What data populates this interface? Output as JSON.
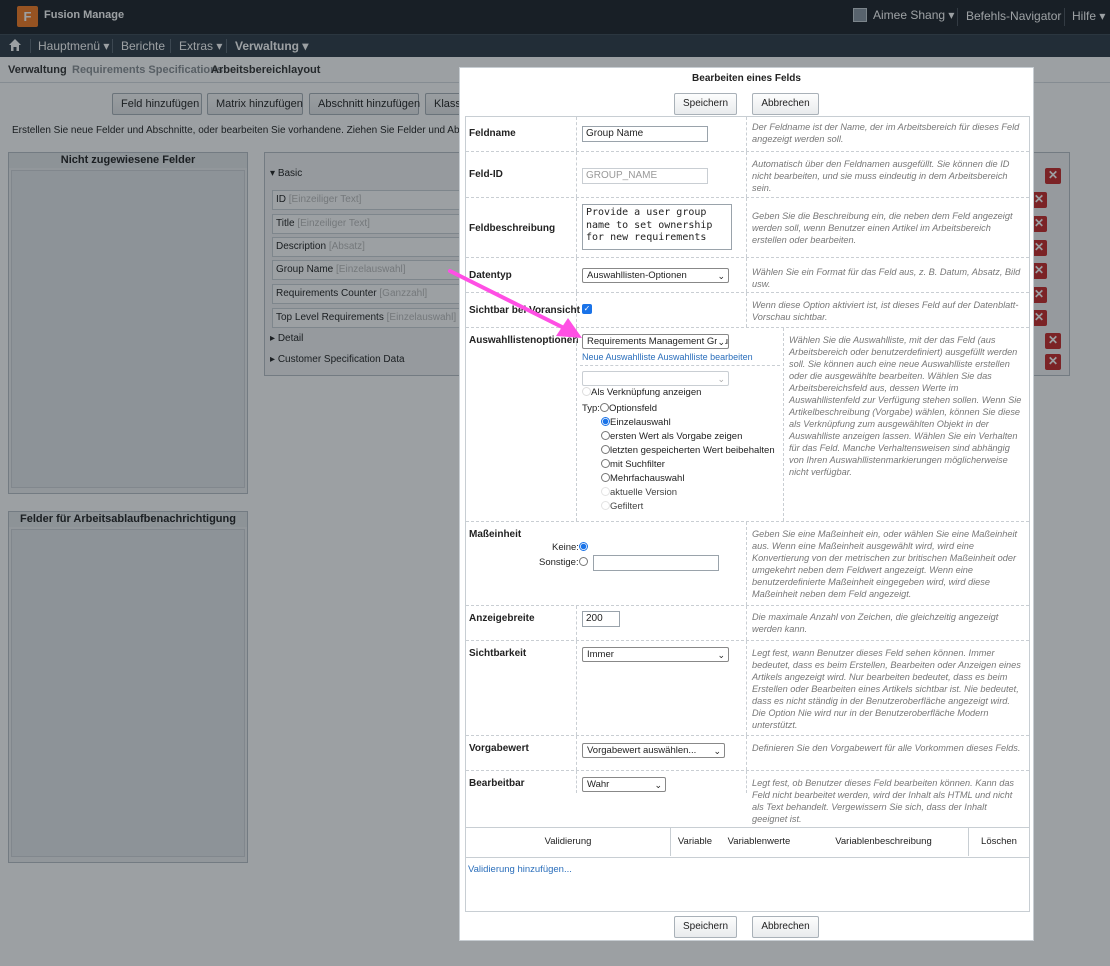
{
  "app": {
    "logo_letter": "F",
    "name": "Fusion Manage"
  },
  "topbar": {
    "user": "Aimee Shang ▾",
    "command_nav": "Befehls-Navigator",
    "help": "Hilfe ▾"
  },
  "nav": {
    "main": "Hauptmenü ▾",
    "reports": "Berichte",
    "extras": "Extras ▾",
    "admin": "Verwaltung ▾"
  },
  "breadcrumb": {
    "root": "Verwaltung",
    "mid": "Requirements Specifications",
    "current": "Arbeitsbereichlayout"
  },
  "background": {
    "buttons": [
      "Feld hinzufügen",
      "Matrix hinzufügen",
      "Abschnitt hinzufügen",
      "Klassi"
    ],
    "instruction": "Erstellen Sie neue Felder und Abschnitte, oder bearbeiten Sie vorhandene. Ziehen Sie Felder und Abschn",
    "unassigned_title": "Nicht zugewiesene Felder",
    "workflow_title": "Felder für Arbeitsablaufbenachrichtigung",
    "sections": {
      "basic": "Basic",
      "detail": "Detail",
      "customer": "Customer Specification Data"
    },
    "fields": [
      {
        "name": "ID",
        "type": "[Einzeiliger Text]"
      },
      {
        "name": "Title",
        "type": "[Einzeiliger Text]"
      },
      {
        "name": "Description",
        "type": "[Absatz]"
      },
      {
        "name": "Group Name",
        "type": "[Einzelauswahl]"
      },
      {
        "name": "Requirements Counter",
        "type": "[Ganzzahl]"
      },
      {
        "name": "Top Level Requirements",
        "type": "[Einzelauswahl]"
      }
    ]
  },
  "dialog": {
    "title": "Bearbeiten eines Felds",
    "save": "Speichern",
    "cancel": "Abbrechen",
    "rows": {
      "fieldname": {
        "label": "Feldname",
        "value": "Group Name",
        "help": "Der Feldname ist der Name, der im Arbeitsbereich für dieses Feld angezeigt werden soll."
      },
      "fieldid": {
        "label": "Feld-ID",
        "value": "GROUP_NAME",
        "help": "Automatisch über den Feldnamen ausgefüllt. Sie können die ID nicht bearbeiten, und sie muss eindeutig in dem Arbeitsbereich sein."
      },
      "description": {
        "label": "Feldbeschreibung",
        "value": "Provide a user group name to set ownership for new requirements",
        "help": "Geben Sie die Beschreibung ein, die neben dem Feld angezeigt werden soll, wenn Benutzer einen Artikel im Arbeitsbereich erstellen oder bearbeiten."
      },
      "datatype": {
        "label": "Datentyp",
        "value": "Auswahllisten-Optionen",
        "help": "Wählen Sie ein Format für das Feld aus, z. B. Datum, Absatz, Bild usw."
      },
      "preview": {
        "label": "Sichtbar bei Voransicht",
        "help": "Wenn diese Option aktiviert ist, ist dieses Feld auf der Datenblatt-Vorschau sichtbar."
      },
      "picklist": {
        "label": "Auswahllistenoptionen",
        "value": "Requirements Management Groups",
        "links": "Neue Auswahlliste Auswahlliste bearbeiten",
        "show_link": "Als Verknüpfung anzeigen",
        "type_label": "Typ:",
        "options": [
          "Optionsfeld",
          "Einzelauswahl",
          "ersten Wert als Vorgabe zeigen",
          "letzten gespeicherten Wert beibehalten",
          "mit Suchfilter",
          "Mehrfachauswahl",
          "aktuelle Version",
          "Gefiltert"
        ],
        "help": "Wählen Sie die Auswahlliste, mit der das Feld (aus Arbeitsbereich oder benutzerdefiniert) ausgefüllt werden soll. Sie können auch eine neue Auswahlliste erstellen oder die ausgewählte bearbeiten. Wählen Sie das Arbeitsbereichsfeld aus, dessen Werte im Auswahllistenfeld zur Verfügung stehen sollen. Wenn Sie Artikelbeschreibung (Vorgabe) wählen, können Sie diese als Verknüpfung zum ausgewählten Objekt in der Auswahlliste anzeigen lassen. Wählen Sie ein Verhalten für das Feld. Manche Verhaltensweisen sind abhängig von Ihren Auswahllistenmarkierungen möglicherweise nicht verfügbar."
      },
      "unit": {
        "label": "Maßeinheit",
        "none": "Keine:",
        "other": "Sonstige:",
        "help": "Geben Sie eine Maßeinheit ein, oder wählen Sie eine Maßeinheit aus. Wenn eine Maßeinheit ausgewählt wird, wird eine Konvertierung von der metrischen zur britischen Maßeinheit oder umgekehrt neben dem Feldwert angezeigt. Wenn eine benutzerdefinierte Maßeinheit eingegeben wird, wird diese Maßeinheit neben dem Feld angezeigt."
      },
      "width": {
        "label": "Anzeigebreite",
        "value": "200",
        "help": "Die maximale Anzahl von Zeichen, die gleichzeitig angezeigt werden kann."
      },
      "visibility": {
        "label": "Sichtbarkeit",
        "value": "Immer",
        "help": "Legt fest, wann Benutzer dieses Feld sehen können. Immer bedeutet, dass es beim Erstellen, Bearbeiten oder Anzeigen eines Artikels angezeigt wird. Nur bearbeiten bedeutet, dass es beim Erstellen oder Bearbeiten eines Artikels sichtbar ist. Nie bedeutet, dass es nicht ständig in der Benutzeroberfläche angezeigt wird. Die Option Nie wird nur in der Benutzeroberfläche Modern unterstützt."
      },
      "default": {
        "label": "Vorgabewert",
        "value": "Vorgabewert auswählen...",
        "help": "Definieren Sie den Vorgabewert für alle Vorkommen dieses Felds."
      },
      "editable": {
        "label": "Bearbeitbar",
        "value": "Wahr",
        "help": "Legt fest, ob Benutzer dieses Feld bearbeiten können. Kann das Feld nicht bearbeitet werden, wird der Inhalt als HTML und nicht als Text behandelt. Vergewissern Sie sich, dass der Inhalt geeignet ist."
      }
    },
    "validation": {
      "headers": [
        "Validierung",
        "Variable",
        "Variablenwerte",
        "Variablenbeschreibung",
        "Löschen"
      ],
      "add": "Validierung hinzufügen..."
    }
  },
  "colors": {
    "topbar": "#1c2228",
    "navbar": "#2e3a45",
    "accent": "#f57a21",
    "arrow": "#ff4fe4",
    "link": "#2a6ebb",
    "delete": "#c62828"
  }
}
